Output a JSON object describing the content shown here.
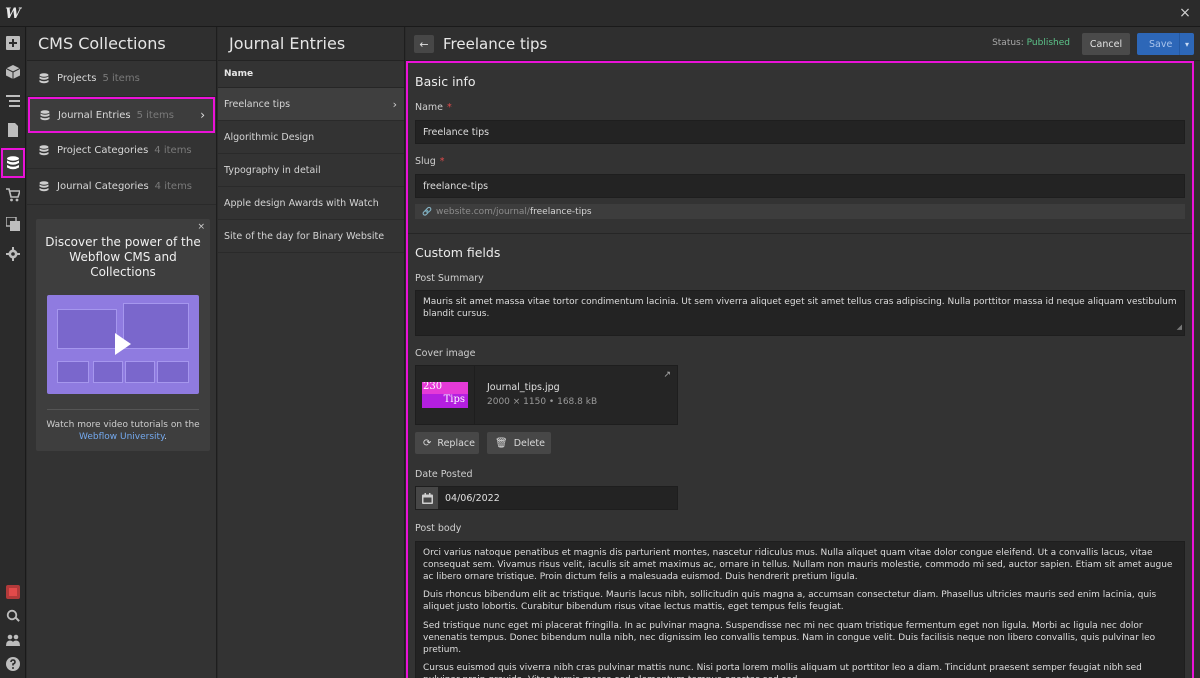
{
  "app": {
    "logo": "W",
    "close_label": "×"
  },
  "rail": {
    "icons": [
      "add-icon",
      "box-icon",
      "navigator-icon",
      "pages-icon",
      "cms-icon",
      "ecommerce-icon",
      "assets-icon",
      "settings-icon",
      "record-icon",
      "search-icon",
      "users-icon",
      "help-icon"
    ]
  },
  "collections": {
    "title": "CMS Collections",
    "items": [
      {
        "name": "Projects",
        "count": "5 items"
      },
      {
        "name": "Journal Entries",
        "count": "5 items"
      },
      {
        "name": "Project Categories",
        "count": "4 items"
      },
      {
        "name": "Journal Categories",
        "count": "4 items"
      }
    ],
    "promo": {
      "close": "×",
      "title": "Discover the power of the Webflow CMS and Collections",
      "text": "Watch more video tutorials on the",
      "link": "Webflow University",
      "link_suffix": "."
    }
  },
  "entries": {
    "title": "Journal Entries",
    "column": "Name",
    "items": [
      "Freelance tips",
      "Algorithmic Design",
      "Typography in detail",
      "Apple design Awards with Watch",
      "Site of the day for Binary Website"
    ]
  },
  "editor": {
    "title": "Freelance tips",
    "status_label": "Status:",
    "status_value": "Published",
    "cancel": "Cancel",
    "save": "Save",
    "colors": {
      "accent": "#ea12d8",
      "save": "#2d67b8",
      "published": "#5cc48a"
    },
    "basic_info": {
      "heading": "Basic info",
      "name_label": "Name",
      "name_value": "Freelance tips",
      "slug_label": "Slug",
      "slug_value": "freelance-tips",
      "slug_url_prefix": "website.com/journal/",
      "slug_url_slug": "freelance-tips",
      "required_mark": "*"
    },
    "custom_fields": {
      "heading": "Custom fields",
      "summary_label": "Post Summary",
      "summary_value": "Mauris sit amet massa vitae tortor condimentum lacinia. Ut sem viverra aliquet eget sit amet tellus cras adipiscing. Nulla porttitor massa id neque aliquam vestibulum blandit cursus.",
      "cover_label": "Cover image",
      "image": {
        "thumb_line1": "230",
        "thumb_line2": "Tips",
        "file_name": "Journal_tips.jpg",
        "meta": "2000 × 1150 • 168.8 kB"
      },
      "replace": "Replace",
      "delete": "Delete",
      "date_label": "Date Posted",
      "date_value": "04/06/2022",
      "body_label": "Post body",
      "body": [
        "Orci varius natoque penatibus et magnis dis parturient montes, nascetur ridiculus mus. Nulla aliquet quam vitae dolor congue eleifend. Ut a convallis lacus, vitae consequat sem. Vivamus risus velit, iaculis sit amet maximus ac, ornare in tellus. Nullam non mauris molestie, commodo mi sed, auctor sapien. Etiam sit amet augue ac libero ornare tristique. Proin dictum felis a malesuada euismod. Duis hendrerit pretium ligula.",
        "Duis rhoncus bibendum elit ac tristique. Mauris lacus nibh, sollicitudin quis magna a, accumsan consectetur diam. Phasellus ultricies mauris sed enim lacinia, quis aliquet justo lobortis. Curabitur bibendum risus vitae lectus mattis, eget tempus felis feugiat.",
        "Sed tristique nunc eget mi placerat fringilla. In ac pulvinar magna. Suspendisse nec mi nec quam tristique fermentum eget non ligula. Morbi ac ligula nec dolor venenatis tempus. Donec bibendum nulla nibh, nec dignissim leo convallis tempus. Nam in congue velit. Duis facilisis neque non libero convallis, quis pulvinar leo pretium.",
        "Cursus euismod quis viverra nibh cras pulvinar mattis nunc. Nisi porta lorem mollis aliquam ut porttitor leo a diam. Tincidunt praesent semper feugiat nibh sed pulvinar proin gravida. Vitae turpis massa sed elementum tempus egestas sed sed."
      ]
    }
  }
}
